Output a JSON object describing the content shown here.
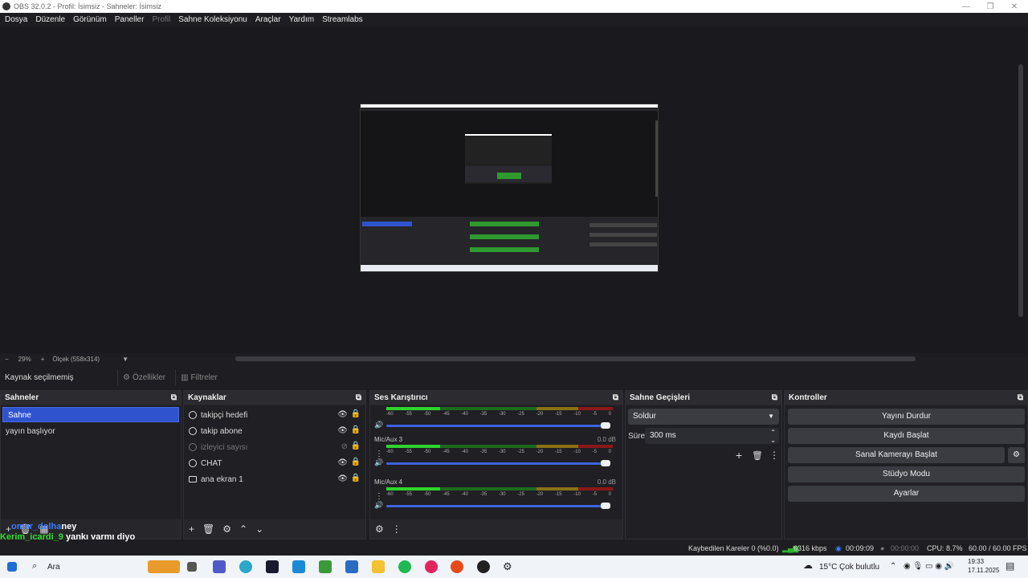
{
  "window": {
    "title": "OBS 32.0.2 - Profil: İsimsiz - Sahneler: İsimsiz"
  },
  "menu": [
    "Dosya",
    "Düzenle",
    "Görünüm",
    "Paneller",
    "Profil",
    "Sahne Koleksiyonu",
    "Araçlar",
    "Yardım",
    "Streamlabs"
  ],
  "zoom": {
    "minus": "−",
    "value": "29%",
    "plus": "+",
    "scale": "Ölçek (558x314)",
    "arrow": "▼"
  },
  "source_toolbar": {
    "no_source": "Kaynak seçilmemiş",
    "properties": "Özellikler",
    "filters": "Filtreler"
  },
  "docks": {
    "scenes": "Sahneler",
    "sources": "Kaynaklar",
    "mixer": "Ses Karıştırıcı",
    "transitions": "Sahne Geçişleri",
    "controls": "Kontroller"
  },
  "scenes": [
    "Sahne",
    "yayın başlıyor"
  ],
  "sources": [
    {
      "name": "takipçi hedefi",
      "icon": "globe-icon",
      "visible": true
    },
    {
      "name": "takip abone",
      "icon": "globe-icon",
      "visible": true
    },
    {
      "name": "izleyici sayısı",
      "icon": "globe-icon",
      "visible": false
    },
    {
      "name": "CHAT",
      "icon": "globe-icon",
      "visible": true
    },
    {
      "name": "ana ekran 1",
      "icon": "monitor-icon",
      "visible": true
    }
  ],
  "mixer": {
    "ticks": [
      "-60",
      "-55",
      "-50",
      "-45",
      "-40",
      "-35",
      "-30",
      "-25",
      "-20",
      "-15",
      "-10",
      "-5",
      "0"
    ],
    "channels": [
      {
        "name": "",
        "db": ""
      },
      {
        "name": "Mic/Aux 3",
        "db": "0.0 dB"
      },
      {
        "name": "Mic/Aux 4",
        "db": "0.0 dB"
      }
    ]
  },
  "transitions": {
    "type": "Soldur",
    "duration_label": "Süre",
    "duration": "300 ms"
  },
  "controls": {
    "stop_stream": "Yayını Durdur",
    "start_record": "Kaydı Başlat",
    "start_virtualcam": "Sanal Kamerayı Başlat",
    "studio_mode": "Stüdyo Modu",
    "settings": "Ayarlar"
  },
  "overlay": {
    "line1_user": "omer_dolha",
    "line1_text": "ney",
    "line2_user": "Kerim_icardi_9",
    "line2_text": "yankı varmı diyo"
  },
  "status": {
    "dropped": "Kaybedilen Kareler 0 (%0.0)",
    "bitrate": "6316 kbps",
    "stream_time": "00:09:09",
    "rec_time": "00:00:00",
    "cpu": "CPU: 8.7%",
    "fps": "60.00 / 60.00 FPS"
  },
  "taskbar": {
    "search": "Ara",
    "weather_temp": "15°C",
    "weather_text": "Çok bulutlu",
    "time": "19:33",
    "date": "17.11.2025"
  },
  "colors": {
    "accent": "#2f53cf",
    "meter_green": "#2fb52f",
    "meter_yellow": "#c8a51e",
    "meter_red": "#c42424"
  }
}
